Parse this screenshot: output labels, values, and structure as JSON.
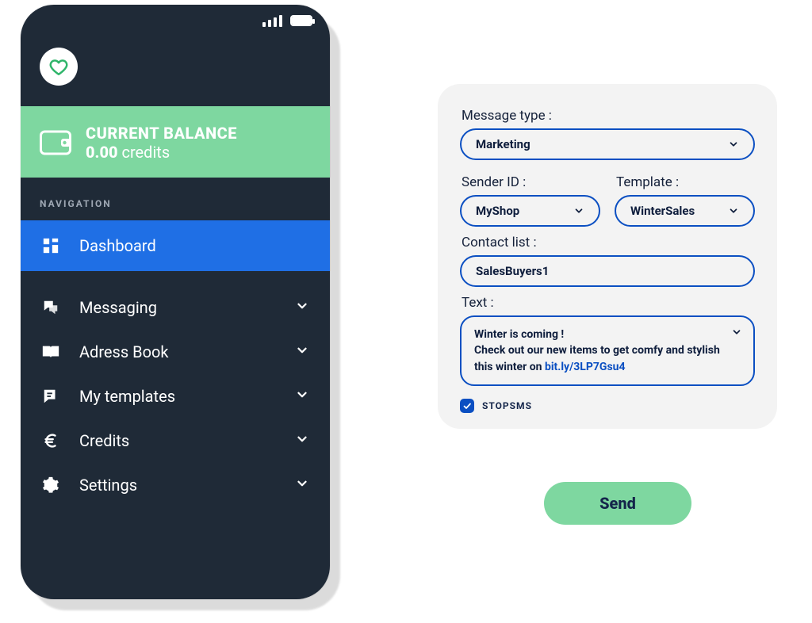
{
  "phone": {
    "balance": {
      "title": "CURRENT BALANCE",
      "amount": "0.00",
      "unit": "credits"
    },
    "nav_header": "NAVIGATION",
    "items": [
      {
        "icon": "dashboard-icon",
        "label": "Dashboard",
        "expandable": false,
        "active": true
      },
      {
        "icon": "messaging-icon",
        "label": "Messaging",
        "expandable": true,
        "active": false
      },
      {
        "icon": "book-icon",
        "label": "Adress Book",
        "expandable": true,
        "active": false
      },
      {
        "icon": "templates-icon",
        "label": "My templates",
        "expandable": true,
        "active": false
      },
      {
        "icon": "euro-icon",
        "label": "Credits",
        "expandable": true,
        "active": false
      },
      {
        "icon": "gear-icon",
        "label": "Settings",
        "expandable": true,
        "active": false
      }
    ]
  },
  "form": {
    "message_type_label": "Message type :",
    "message_type_value": "Marketing",
    "sender_id_label": "Sender ID :",
    "sender_id_value": "MyShop",
    "template_label": "Template :",
    "template_value": "WinterSales",
    "contact_list_label": "Contact list :",
    "contact_list_value": "SalesBuyers1",
    "text_label": "Text :",
    "text_value_line1": "Winter is coming !",
    "text_value_line2": "Check out our new items to get comfy and stylish this winter on",
    "text_value_link": "bit.ly/3LP7Gsu4",
    "stopsms_label": "STOPSMS",
    "stopsms_checked": true
  },
  "send_button_label": "Send",
  "colors": {
    "green": "#7ed7a0",
    "blue": "#1f6fe5",
    "blue_border": "#0b4fc2",
    "phone_bg": "#1f2a37",
    "panel_bg": "#f3f3f3"
  }
}
